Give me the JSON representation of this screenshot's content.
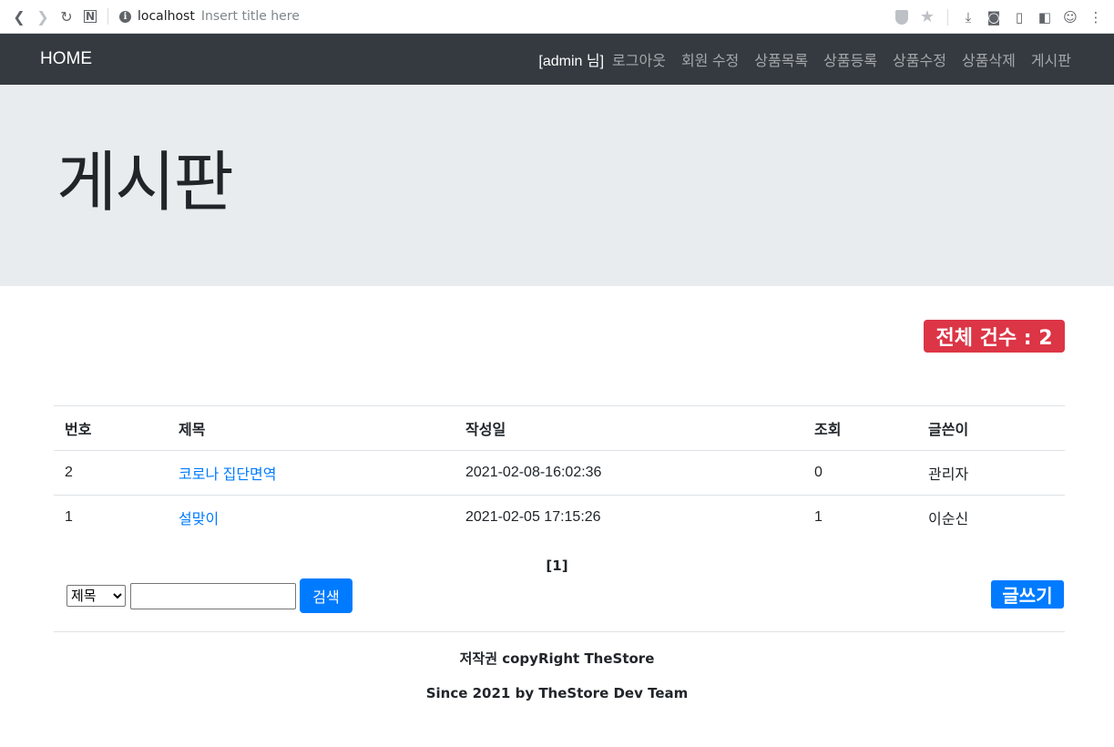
{
  "browser": {
    "host": "localhost",
    "page_title": "Insert title here"
  },
  "navbar": {
    "brand": "HOME",
    "user": "[admin 님]",
    "links": [
      "로그아웃",
      "회원 수정",
      "상품목록",
      "상품등록",
      "상품수정",
      "상품삭제",
      "게시판"
    ]
  },
  "jumbotron": {
    "title": "게시판"
  },
  "count_badge": "전체 건수 : 2",
  "table": {
    "headers": [
      "번호",
      "제목",
      "작성일",
      "조회",
      "글쓴이"
    ],
    "rows": [
      {
        "no": "2",
        "title": "코로나 집단면역",
        "date": "2021-02-08-16:02:36",
        "views": "0",
        "writer": "관리자"
      },
      {
        "no": "1",
        "title": "설맞이",
        "date": "2021-02-05 17:15:26",
        "views": "1",
        "writer": "이순신"
      }
    ]
  },
  "pager": "[1]",
  "search": {
    "select_value": "제목",
    "input_value": "",
    "button": "검색"
  },
  "write_button": "글쓰기",
  "footer": {
    "copyright": "저작권 copyRight TheStore",
    "since": "Since 2021 by TheStore Dev Team"
  },
  "colors": {
    "navbar_bg": "#343a40",
    "jumbotron_bg": "#e9ecef",
    "badge_red": "#dc3545",
    "primary_blue": "#007bff"
  },
  "icons": [
    "back-icon",
    "forward-icon",
    "reload-icon",
    "notion-icon",
    "info-icon",
    "shield-icon",
    "star-icon",
    "download-icon",
    "camera-icon",
    "reader-icon",
    "sidebar-icon",
    "profile-icon",
    "menu-icon"
  ]
}
